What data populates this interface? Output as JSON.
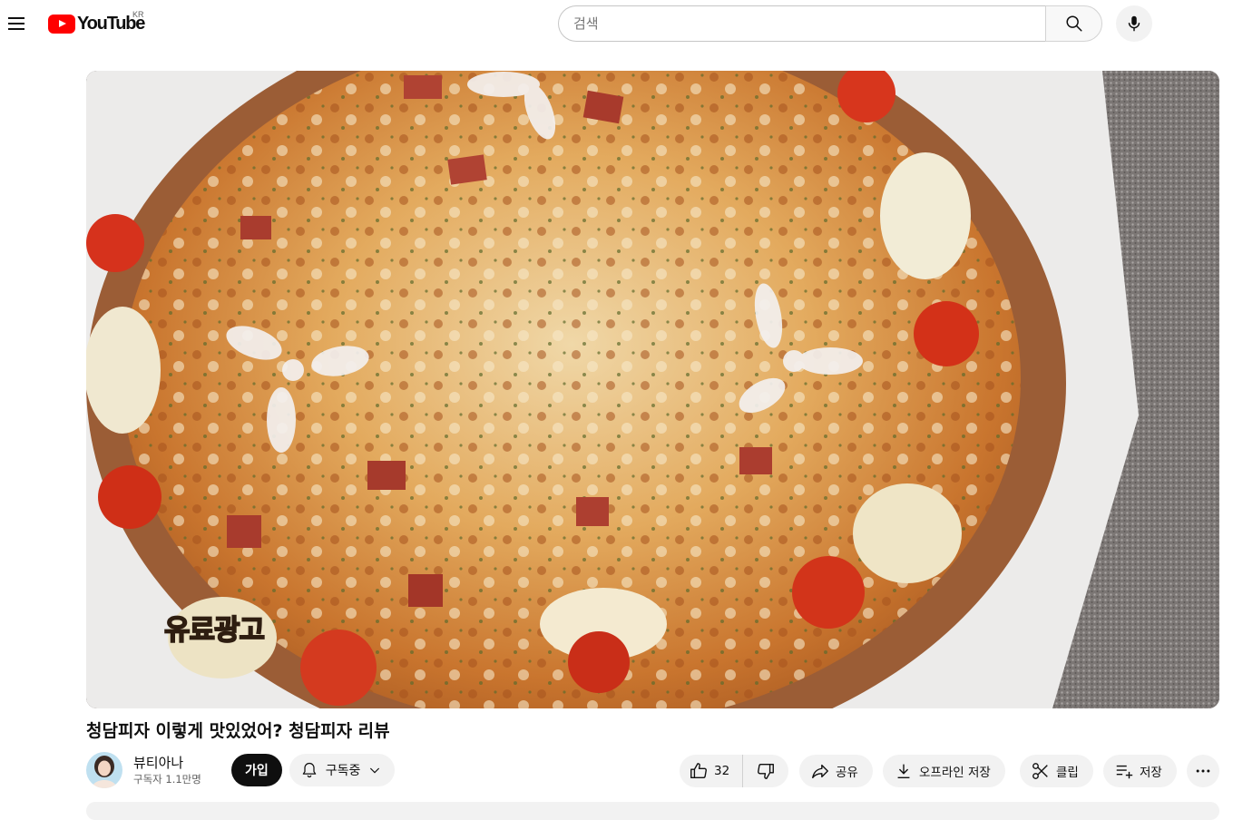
{
  "masthead": {
    "logo_text": "YouTube",
    "country_code": "KR",
    "search_placeholder": "검색",
    "search_value": "",
    "brand_color": "#FF0000"
  },
  "video": {
    "title": "청담피자 이렇게 맛있었어? 청담피자 리뷰",
    "overlay_text": "유료광고"
  },
  "channel": {
    "name": "뷰티아나",
    "subscribers": "구독자 1.1만명"
  },
  "buttons": {
    "join": "가입",
    "subscribed": "구독중",
    "like_count": "32",
    "share": "공유",
    "download": "오프라인 저장",
    "clip": "클립",
    "save": "저장"
  },
  "icons": [
    "menu-icon",
    "youtube-logo-icon",
    "search-icon",
    "mic-icon",
    "bell-icon",
    "chevron-down-icon",
    "like-icon",
    "dislike-icon",
    "share-icon",
    "download-icon",
    "scissors-icon",
    "playlist-add-icon",
    "more-icon"
  ]
}
